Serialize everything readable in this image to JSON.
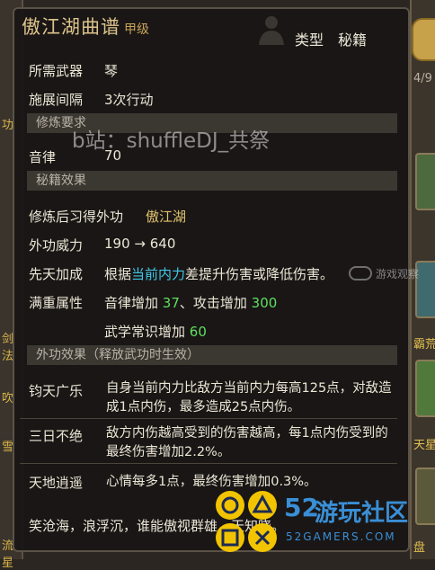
{
  "background": {
    "left_fragments": [
      "功",
      "剑法",
      "吹",
      "雪",
      "流星"
    ],
    "right_fragments": [
      "4/9",
      "霸荒",
      "天星",
      "盘"
    ]
  },
  "title": {
    "name": "傲江湖曲谱",
    "grade": "甲级"
  },
  "type": {
    "label": "类型",
    "value": "秘籍"
  },
  "info": [
    {
      "label": "所需武器",
      "value": "琴"
    },
    {
      "label": "施展间隔",
      "value": "3次行动"
    }
  ],
  "sections": {
    "practice_req": "修炼要求",
    "secret_effect": "秘籍效果",
    "outer_effect": "外功效果（释放武功时生效）"
  },
  "watermark": "b站：shuffleDJ_共祭",
  "music": {
    "label": "音律",
    "value": "70"
  },
  "learn": {
    "label": "修炼后习得外功",
    "value": "傲江湖"
  },
  "power": {
    "label": "外功威力",
    "value": "190 → 640"
  },
  "innate": {
    "label": "先天加成",
    "prefix": "根据",
    "highlight": "当前内力",
    "suffix": "差提升伤害或降低伤害。"
  },
  "full": {
    "label": "满重属性",
    "a_prefix": "音律增加 ",
    "a_val": "37",
    "b_prefix": "、攻击增加 ",
    "b_val": "300",
    "c_prefix": "武学常识增加 ",
    "c_val": "60"
  },
  "effects": [
    {
      "name": "钧天广乐",
      "text": "自身当前内力比敌方当前内力每高125点，对敌造成1点内伤，最多造成25点内伤。"
    },
    {
      "name": "三日不绝",
      "text": "敌方内伤越高受到的伤害越高，每1点内伤受到的最终伤害增加2.2%。"
    },
    {
      "name": "天地逍遥",
      "text": "心情每多1点，最终伤害增加0.3%。"
    }
  ],
  "footer": "笑沧海，浪浮沉，谁能傲视群雄，天知晓。",
  "logo": {
    "num": "52",
    "cn": "游玩社区",
    "en": "52GAMERS.COM"
  },
  "side_watermark": "游戏观察",
  "colors": {
    "title": "#ddc38a",
    "highlight": "#41c8e8",
    "bonus": "#5fe05f",
    "value_gold": "#e1c36f"
  }
}
